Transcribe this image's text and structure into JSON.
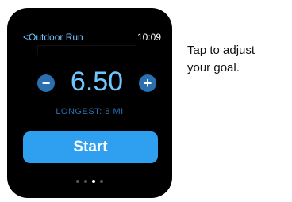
{
  "workout": {
    "back_label": "<Outdoor Run",
    "time": "10:09",
    "goal_value": "6.50",
    "minus_label": "−",
    "plus_label": "+",
    "longest": "LONGEST: 8 MI",
    "start_label": "Start"
  },
  "pager": {
    "count": 4,
    "active_index": 2
  },
  "callout": {
    "line1": "Tap to adjust",
    "line2": "your goal."
  },
  "colors": {
    "accent": "#6ec6ff",
    "button": "#2f9ff0",
    "dim_blue": "#2a6fb0"
  }
}
